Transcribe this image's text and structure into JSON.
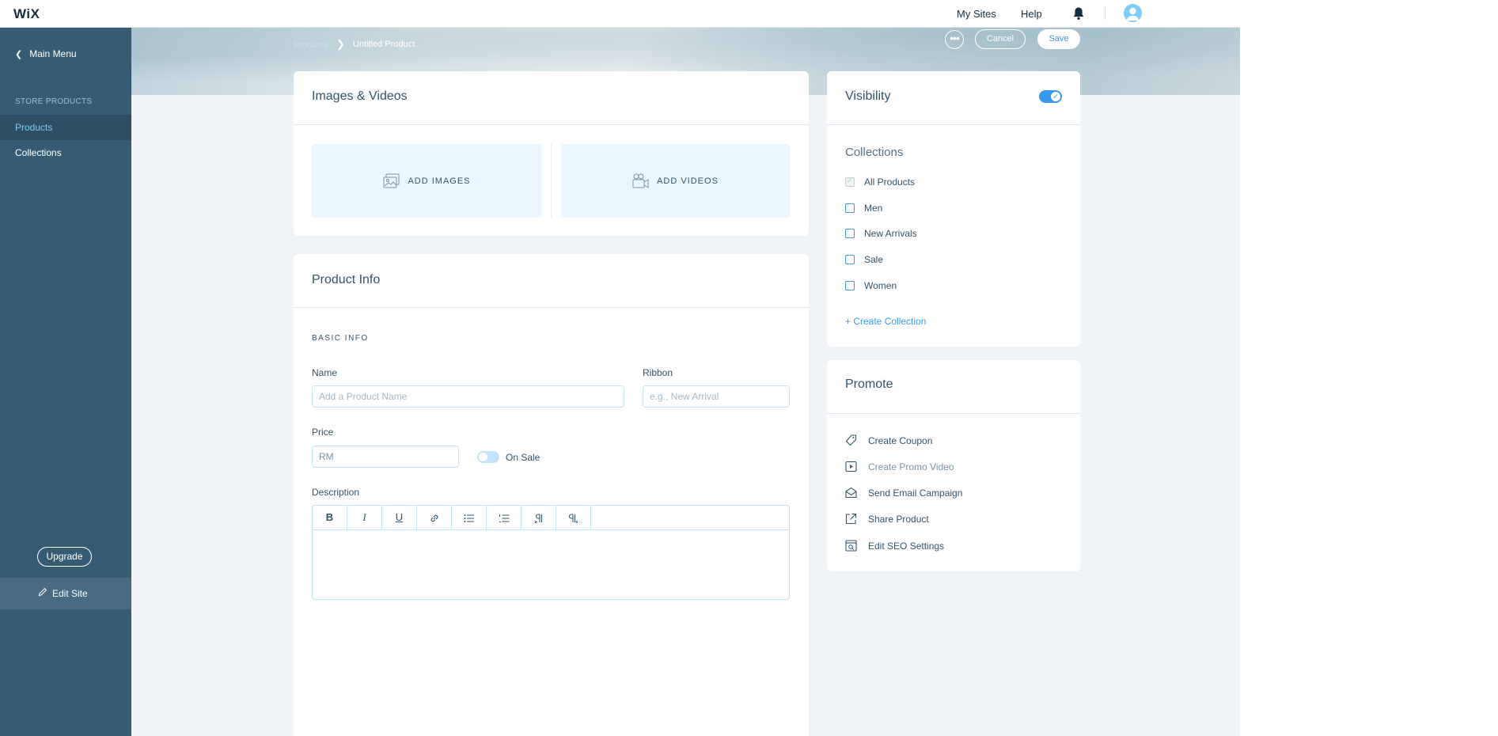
{
  "app": {
    "logo": "WiX",
    "top_links": [
      "My Sites",
      "Help"
    ],
    "icons": {
      "bell": "bell-icon",
      "avatar": "avatar-icon"
    }
  },
  "sidebar": {
    "main_menu": "Main Menu",
    "section": "STORE PRODUCTS",
    "items": [
      {
        "label": "Products",
        "active": true
      },
      {
        "label": "Collections",
        "active": false
      }
    ],
    "upgrade": "Upgrade",
    "edit_site": "Edit Site"
  },
  "header": {
    "breadcrumb_parent": "Products",
    "breadcrumb_current": "Untitled Product",
    "more": "•••",
    "cancel": "Cancel",
    "save": "Save"
  },
  "images_videos": {
    "title": "Images & Videos",
    "add_images": "ADD IMAGES",
    "add_videos": "ADD VIDEOS"
  },
  "product_info": {
    "title": "Product Info",
    "section": "BASIC INFO",
    "name_label": "Name",
    "name_placeholder": "Add a Product Name",
    "ribbon_label": "Ribbon",
    "ribbon_placeholder": "e.g., New Arrival",
    "price_label": "Price",
    "price_value": "RM",
    "on_sale": "On Sale",
    "description_label": "Description",
    "toolbar": [
      "B",
      "I",
      "U",
      "link",
      "bulleted-list",
      "numbered-list",
      "ltr",
      "rtl"
    ]
  },
  "visibility": {
    "title": "Visibility",
    "enabled": true,
    "collections_title": "Collections",
    "collections": [
      {
        "label": "All Products",
        "checked": true
      },
      {
        "label": "Men",
        "checked": false
      },
      {
        "label": "New Arrivals",
        "checked": false
      },
      {
        "label": "Sale",
        "checked": false
      },
      {
        "label": "Women",
        "checked": false
      }
    ],
    "create_collection": "+ Create Collection"
  },
  "promote": {
    "title": "Promote",
    "items": [
      {
        "label": "Create Coupon",
        "icon": "coupon-icon"
      },
      {
        "label": "Create Promo Video",
        "icon": "video-play-icon"
      },
      {
        "label": "Send Email Campaign",
        "icon": "email-icon"
      },
      {
        "label": "Share Product",
        "icon": "share-icon"
      },
      {
        "label": "Edit SEO Settings",
        "icon": "seo-icon"
      }
    ]
  },
  "colors": {
    "accent": "#3899ec",
    "sidebar": "#385b74",
    "text": "#32536a"
  }
}
